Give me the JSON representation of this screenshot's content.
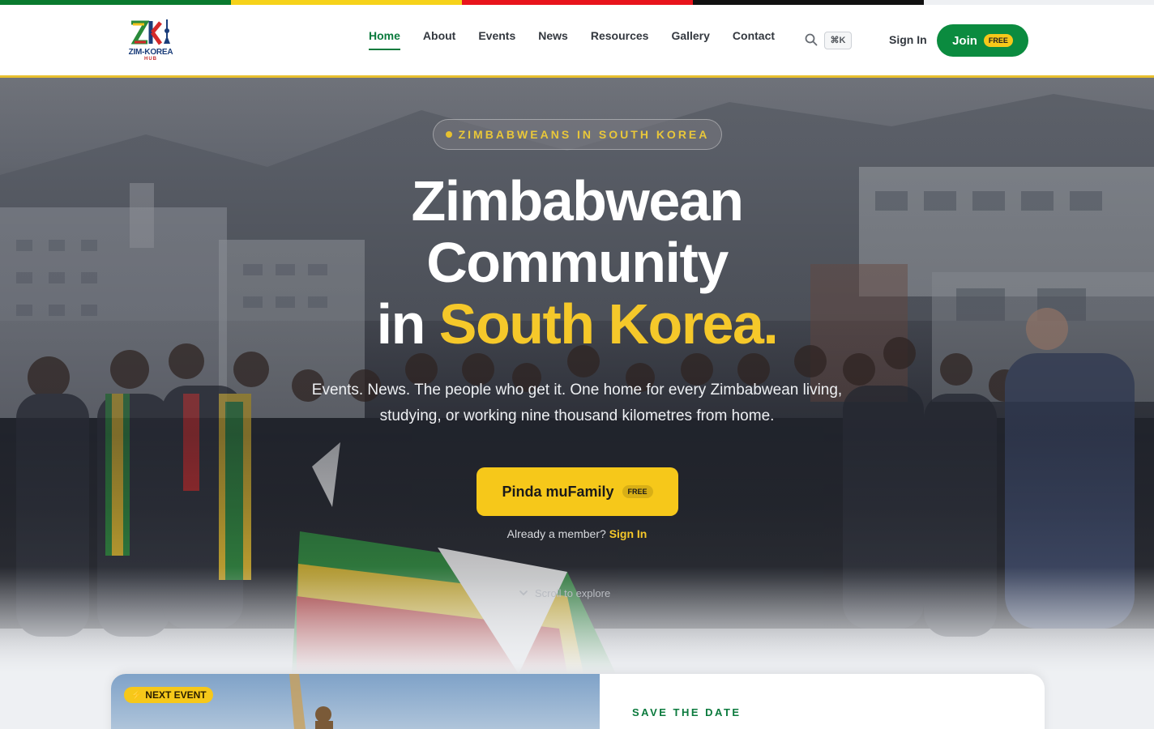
{
  "flag_colors": [
    "#0a7a2f",
    "#f6d21a",
    "#e8141c",
    "#111111"
  ],
  "header": {
    "logo": {
      "mark": "ZK",
      "text": "ZIM-KOREA",
      "subtext": "HUB"
    },
    "nav": [
      {
        "label": "Home",
        "active": true
      },
      {
        "label": "About"
      },
      {
        "label": "Events"
      },
      {
        "label": "News"
      },
      {
        "label": "Resources"
      },
      {
        "label": "Gallery"
      },
      {
        "label": "Contact"
      }
    ],
    "search_icon": "search-icon",
    "shortcut": "⌘K",
    "signin_label": "Sign In",
    "join_label": "Join",
    "join_badge": "FREE"
  },
  "hero": {
    "eyebrow": "ZIMBABWEANS IN SOUTH KOREA",
    "title_line1": "Zimbabwean",
    "title_line2": "Community",
    "title_line3_prefix": "in ",
    "title_line3_highlight": "South Korea.",
    "lead": "Events. News. The people who get it. One home for every Zimbabwean living, studying, or working nine thousand kilometres from home.",
    "cta_label": "Pinda muFamily",
    "cta_badge": "FREE",
    "member_prompt": "Already a member?",
    "member_link": "Sign In",
    "scroll_label": "Scroll to explore",
    "scroll_icon": "chevron-down-icon"
  },
  "event_card": {
    "badge": "⚡ NEXT EVENT",
    "save_the_date": "SAVE THE DATE"
  },
  "colors": {
    "brand_green": "#0b8b3f",
    "brand_yellow": "#f6c81a"
  }
}
